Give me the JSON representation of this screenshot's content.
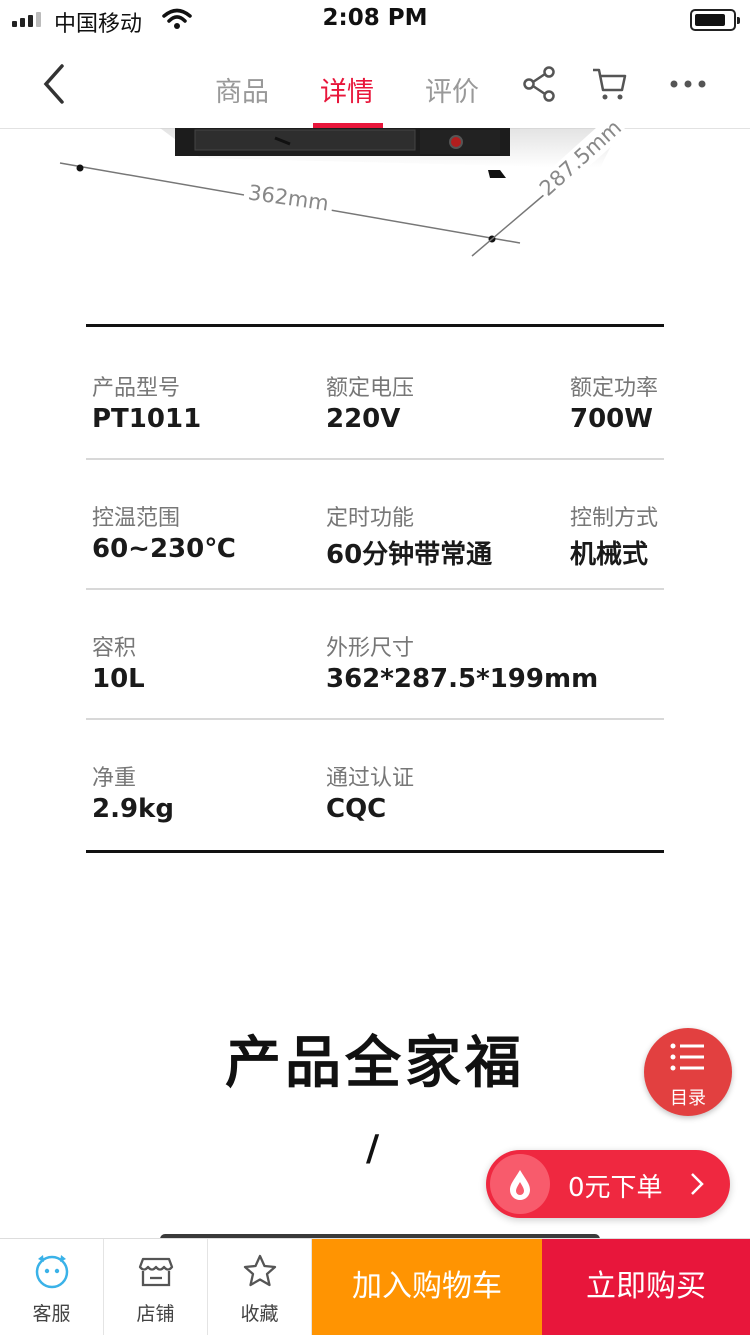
{
  "status_bar": {
    "carrier": "中国移动",
    "time": "2:08 PM"
  },
  "nav": {
    "tabs": [
      {
        "label": "商品",
        "active": false
      },
      {
        "label": "详情",
        "active": true
      },
      {
        "label": "评价",
        "active": false
      }
    ],
    "accent_color": "#e8163b"
  },
  "diagram": {
    "width_label": "362mm",
    "depth_label": "287.5mm"
  },
  "specs": [
    [
      {
        "label": "产品型号",
        "value": "PT1011"
      },
      {
        "label": "额定电压",
        "value": "220V"
      },
      {
        "label": "额定功率",
        "value": "700W"
      }
    ],
    [
      {
        "label": "控温范围",
        "value": "60~230℃"
      },
      {
        "label": "定时功能",
        "value": "60分钟带常通"
      },
      {
        "label": "控制方式",
        "value": "机械式"
      }
    ],
    [
      {
        "label": "容积",
        "value": "10L"
      },
      {
        "label": "外形尺寸",
        "value": "362*287.5*199mm"
      }
    ],
    [
      {
        "label": "净重",
        "value": "2.9kg"
      },
      {
        "label": "通过认证",
        "value": "CQC"
      }
    ]
  ],
  "section": {
    "title": "产品全家福",
    "mark": "/"
  },
  "toc": {
    "label": "目录",
    "icon": "list-icon"
  },
  "order_pill": {
    "text": "0元下单"
  },
  "bottom_bar": {
    "service_label": "客服",
    "shop_label": "店铺",
    "favorite_label": "收藏",
    "add_cart_label": "加入购物车",
    "buy_now_label": "立即购买",
    "add_cart_color": "#ff9402",
    "buy_now_color": "#e8163b"
  }
}
